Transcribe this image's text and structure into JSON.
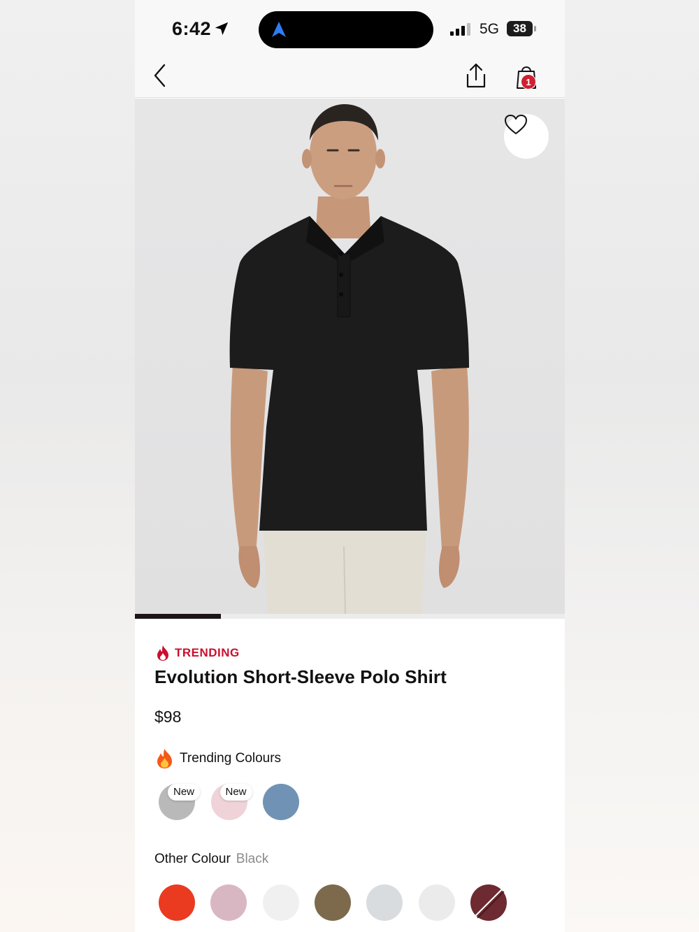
{
  "status_bar": {
    "time": "6:42",
    "network": "5G",
    "battery": "38"
  },
  "nav": {
    "back_icon": "chevron-left-icon",
    "share_icon": "share-icon",
    "bag_icon": "shopping-bag-icon",
    "bag_count": "1"
  },
  "hero": {
    "favourite_icon": "heart-icon",
    "gallery_progress": 0.2
  },
  "product": {
    "badge_label": "TRENDING",
    "title": "Evolution Short-Sleeve Polo Shirt",
    "price": "$98"
  },
  "trending_colours": {
    "label": "Trending Colours",
    "swatches": [
      {
        "color": "#b9b9b9",
        "tag": "New"
      },
      {
        "color": "#efd3d8",
        "tag": "New"
      },
      {
        "color": "#7093b5",
        "tag": ""
      }
    ]
  },
  "other_colours": {
    "label": "Other Colour",
    "selected": "Black",
    "swatches": [
      {
        "color": "#ea3a1f"
      },
      {
        "color": "#d9b7c2"
      },
      {
        "color": "#f0f0f0"
      },
      {
        "color": "#7d6a4d"
      },
      {
        "color": "#d8dcde"
      },
      {
        "color": "#ebebeb"
      },
      {
        "color": "#6d2a30",
        "sold_out": true
      }
    ]
  },
  "colors": {
    "accent": "#c8102e",
    "badge": "#d21f31"
  }
}
